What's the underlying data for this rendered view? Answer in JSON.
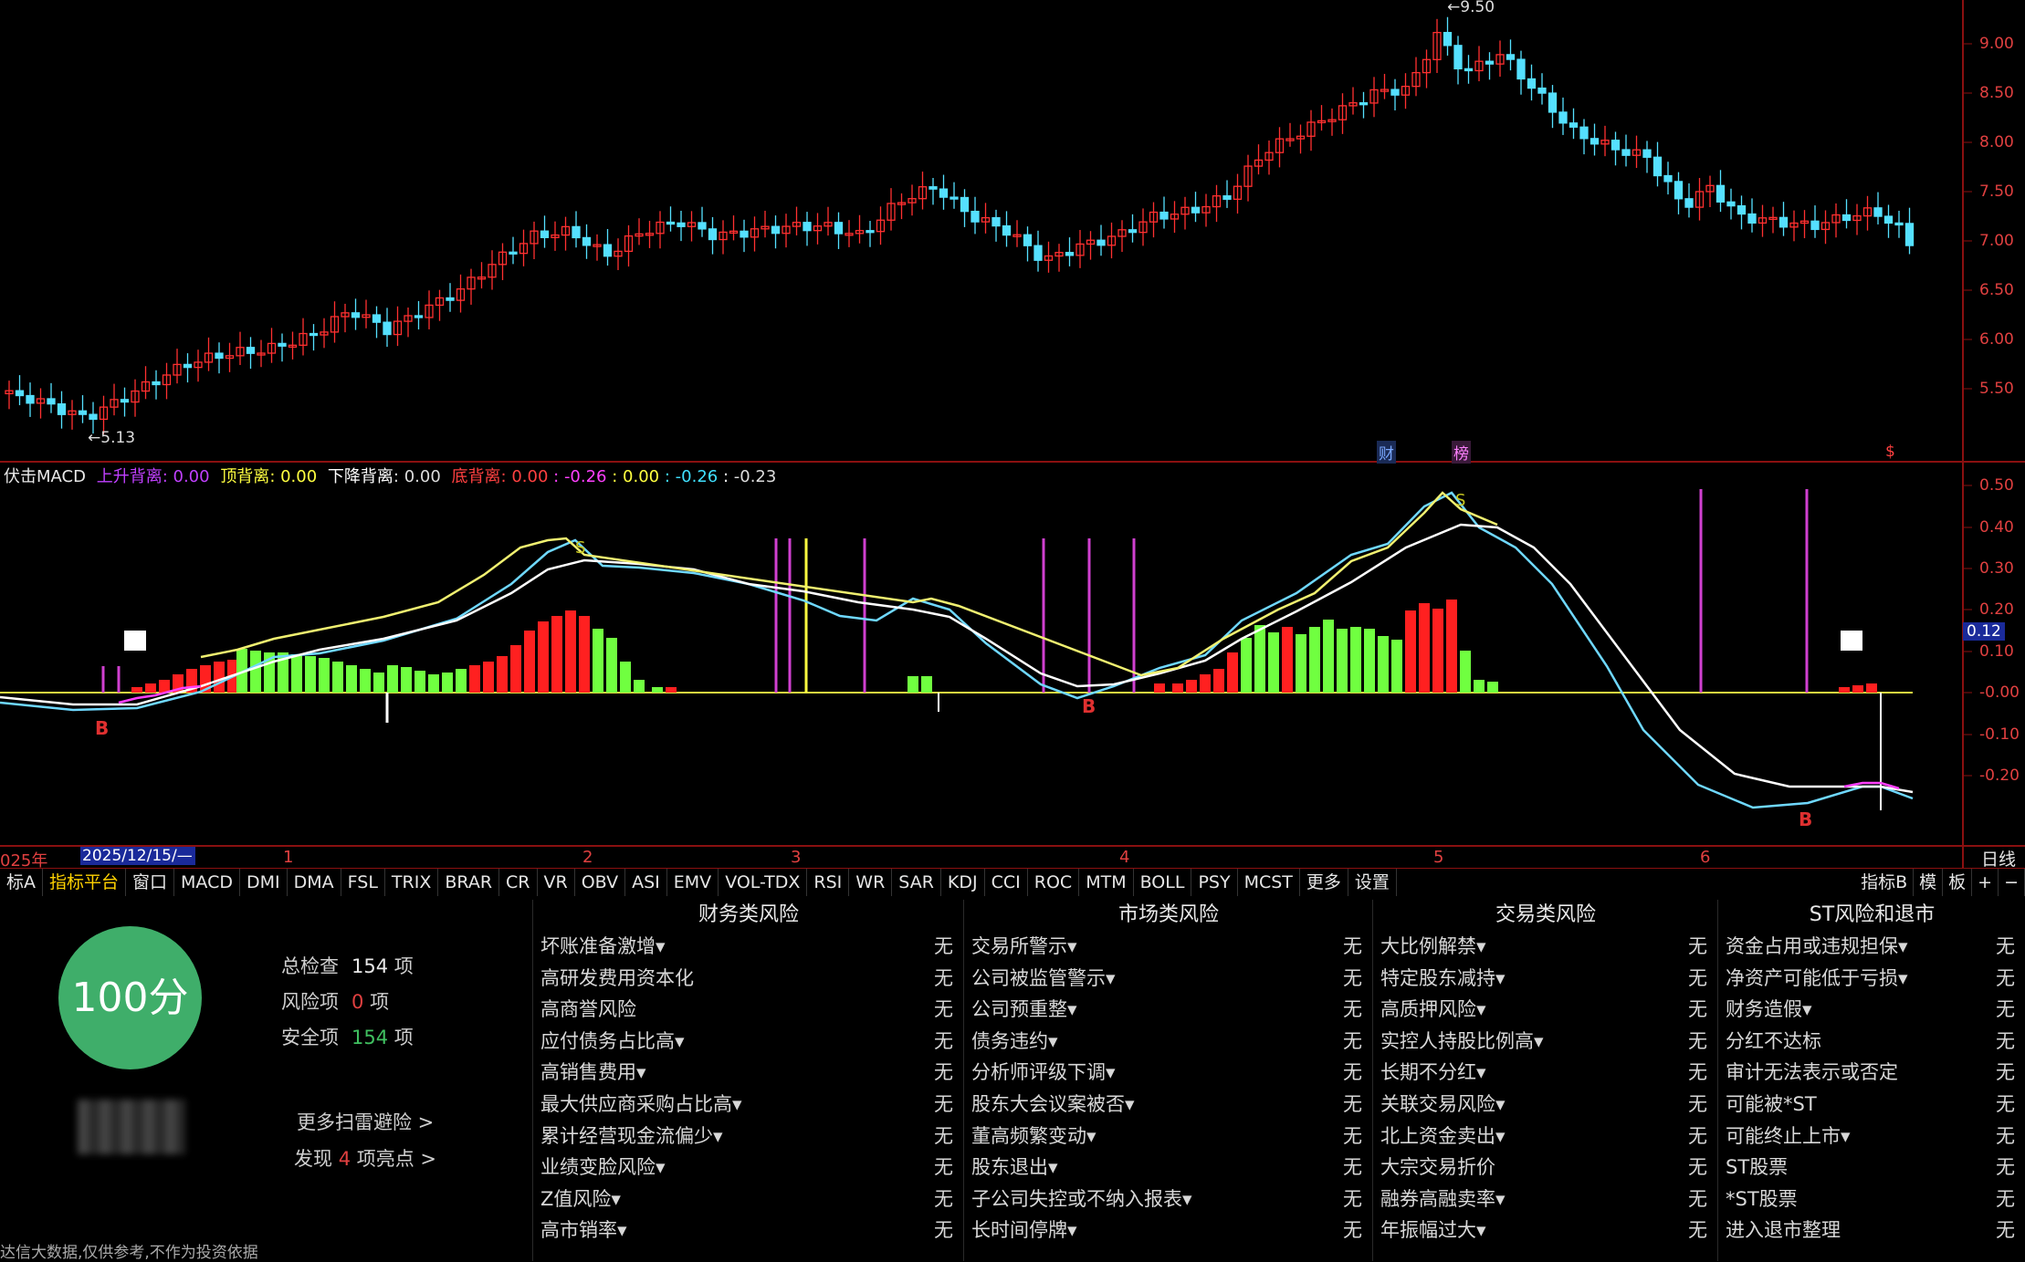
{
  "price_chart": {
    "high_label": "9.50",
    "low_label": "5.13",
    "y_ticks": [
      "9.00",
      "8.50",
      "8.00",
      "7.50",
      "7.00",
      "6.50",
      "6.00",
      "5.50"
    ],
    "markers": [
      "财",
      "榜",
      "$"
    ]
  },
  "macd": {
    "name": "伏击MACD",
    "legend": [
      {
        "label": "上升背离",
        "value": "0.00",
        "color": "#c040ff"
      },
      {
        "label": "顶背离",
        "value": "0.00",
        "color": "#ffff40"
      },
      {
        "label": "下降背离",
        "value": "0.00",
        "color": "#ffffff"
      },
      {
        "label": "底背离",
        "value": "0.00",
        "color": "#ff4040"
      }
    ],
    "extra_values": [
      "-0.26",
      "0.00",
      "-0.26",
      "-0.23"
    ],
    "y_ticks": [
      "0.50",
      "0.40",
      "0.30",
      "0.20",
      "0.10",
      "-0.00",
      "-0.10",
      "-0.20"
    ],
    "current_value": "0.12",
    "signals": [
      "B",
      "B",
      "B",
      "S",
      "S"
    ]
  },
  "date_axis": {
    "year": "025年",
    "cursor_date": "2025/12/15/—",
    "months": [
      "1",
      "2",
      "3",
      "4",
      "5",
      "6"
    ],
    "period": "日线"
  },
  "toolbar": {
    "items": [
      "标A",
      "指标平台",
      "窗口",
      "MACD",
      "DMI",
      "DMA",
      "FSL",
      "TRIX",
      "BRAR",
      "CR",
      "VR",
      "OBV",
      "ASI",
      "EMV",
      "VOL-TDX",
      "RSI",
      "WR",
      "SAR",
      "KDJ",
      "CCI",
      "ROC",
      "MTM",
      "BOLL",
      "PSY",
      "MCST",
      "更多",
      "设置"
    ],
    "right_items": [
      "指标B",
      "模",
      "板",
      "+",
      "−"
    ]
  },
  "summary": {
    "score": "100分",
    "total_label": "总检查",
    "total_value": "154",
    "unit": "项",
    "risk_label": "风险项",
    "risk_value": "0",
    "safe_label": "安全项",
    "safe_value": "154",
    "more_link": "更多扫雷避险 >",
    "highlight_prefix": "发现",
    "highlight_count": "4",
    "highlight_suffix": "项亮点 >",
    "footnote": "达信大数据,仅供参考,不作为投资依据"
  },
  "risk_columns": [
    {
      "title": "财务类风险",
      "rows": [
        {
          "name": "坏账准备激增▾",
          "value": "无"
        },
        {
          "name": "高研发费用资本化",
          "value": "无"
        },
        {
          "name": "高商誉风险",
          "value": "无"
        },
        {
          "name": "应付债务占比高▾",
          "value": "无"
        },
        {
          "name": "高销售费用▾",
          "value": "无"
        },
        {
          "name": "最大供应商采购占比高▾",
          "value": "无"
        },
        {
          "name": "累计经营现金流偏少▾",
          "value": "无"
        },
        {
          "name": "业绩变脸风险▾",
          "value": "无"
        },
        {
          "name": "Z值风险▾",
          "value": "无"
        },
        {
          "name": "高市销率▾",
          "value": "无"
        }
      ]
    },
    {
      "title": "市场类风险",
      "rows": [
        {
          "name": "交易所警示▾",
          "value": "无"
        },
        {
          "name": "公司被监管警示▾",
          "value": "无"
        },
        {
          "name": "公司预重整▾",
          "value": "无"
        },
        {
          "name": "债务违约▾",
          "value": "无"
        },
        {
          "name": "分析师评级下调▾",
          "value": "无"
        },
        {
          "name": "股东大会议案被否▾",
          "value": "无"
        },
        {
          "name": "董高频繁变动▾",
          "value": "无"
        },
        {
          "name": "股东退出▾",
          "value": "无"
        },
        {
          "name": "子公司失控或不纳入报表▾",
          "value": "无"
        },
        {
          "name": "长时间停牌▾",
          "value": "无"
        }
      ]
    },
    {
      "title": "交易类风险",
      "rows": [
        {
          "name": "大比例解禁▾",
          "value": "无"
        },
        {
          "name": "特定股东减持▾",
          "value": "无"
        },
        {
          "name": "高质押风险▾",
          "value": "无"
        },
        {
          "name": "实控人持股比例高▾",
          "value": "无"
        },
        {
          "name": "长期不分红▾",
          "value": "无"
        },
        {
          "name": "关联交易风险▾",
          "value": "无"
        },
        {
          "name": "北上资金卖出▾",
          "value": "无"
        },
        {
          "name": "大宗交易折价",
          "value": "无"
        },
        {
          "name": "融券高融卖率▾",
          "value": "无"
        },
        {
          "name": "年振幅过大▾",
          "value": "无"
        }
      ]
    },
    {
      "title": "ST风险和退市",
      "rows": [
        {
          "name": "资金占用或违规担保▾",
          "value": "无"
        },
        {
          "name": "净资产可能低于亏损▾",
          "value": "无"
        },
        {
          "name": "财务造假▾",
          "value": "无"
        },
        {
          "name": "分红不达标",
          "value": "无"
        },
        {
          "name": "审计无法表示或否定",
          "value": "无"
        },
        {
          "name": "可能被*ST",
          "value": "无"
        },
        {
          "name": "可能终止上市▾",
          "value": "无"
        },
        {
          "name": "ST股票",
          "value": "无"
        },
        {
          "name": "*ST股票",
          "value": "无"
        },
        {
          "name": "进入退市整理",
          "value": "无"
        }
      ]
    }
  ]
}
